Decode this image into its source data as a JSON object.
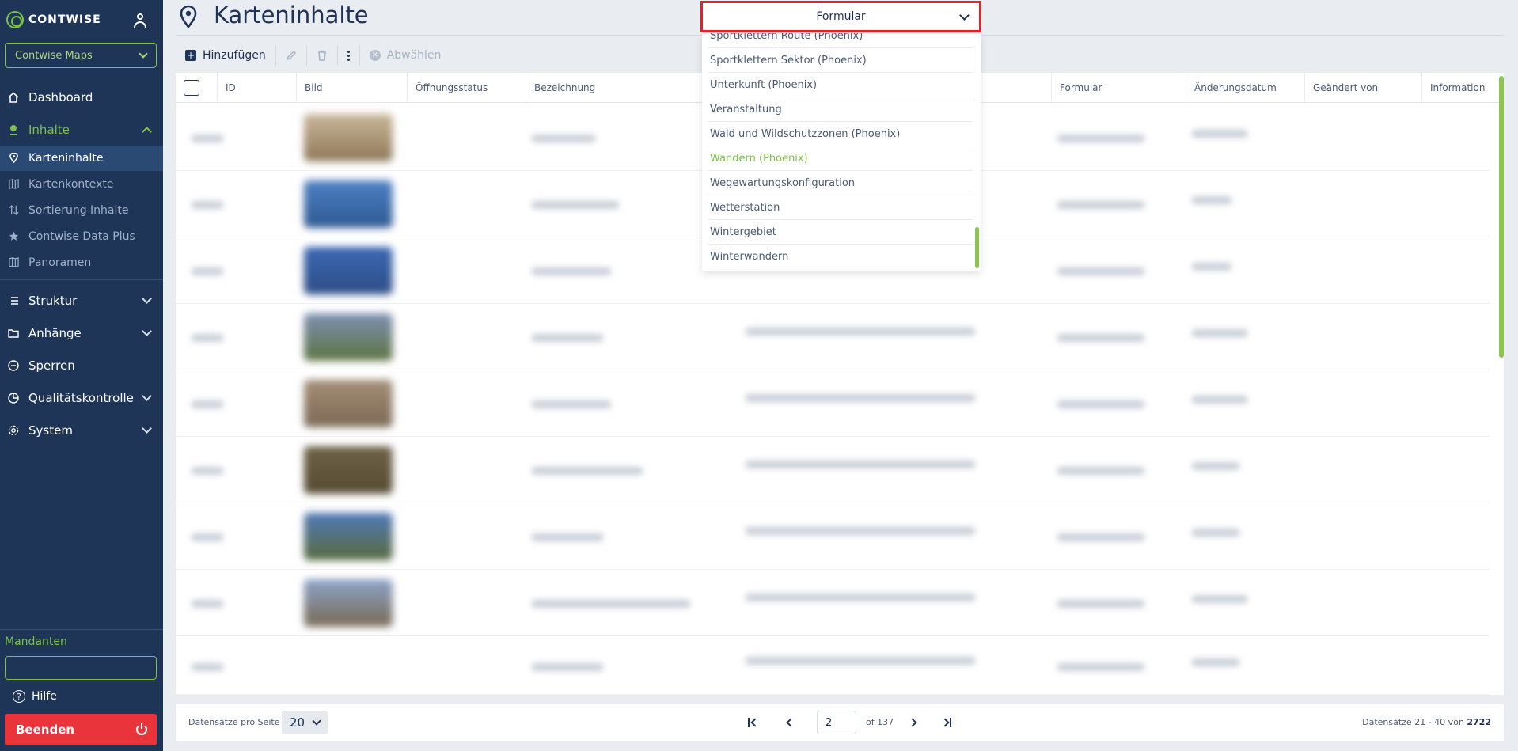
{
  "app": {
    "brand": "CONTWISE",
    "tenant": "Contwise Maps"
  },
  "sidebar": {
    "items": [
      {
        "label": "Dashboard"
      },
      {
        "label": "Inhalte"
      },
      {
        "label": "Struktur"
      },
      {
        "label": "Anhänge"
      },
      {
        "label": "Sperren"
      },
      {
        "label": "Qualitätskontrolle"
      },
      {
        "label": "System"
      }
    ],
    "subitems": [
      {
        "label": "Karteninhalte"
      },
      {
        "label": "Kartenkontexte"
      },
      {
        "label": "Sortierung Inhalte"
      },
      {
        "label": "Contwise Data Plus"
      },
      {
        "label": "Panoramen"
      }
    ],
    "mandanten_label": "Mandanten",
    "mandanten_value": "",
    "help": "Hilfe",
    "logout": "Beenden"
  },
  "header": {
    "title": "Karteninhalte"
  },
  "toolbar": {
    "add": "Hinzufügen",
    "deselect": "Abwählen"
  },
  "filter": {
    "selected": "Formular",
    "options": [
      "Sportklettern Route (Phoenix)",
      "Sportklettern Sektor (Phoenix)",
      "Unterkunft (Phoenix)",
      "Veranstaltung",
      "Wald und Wildschutzzonen (Phoenix)",
      "Wandern (Phoenix)",
      "Wegewartungskonfiguration",
      "Wetterstation",
      "Wintergebiet",
      "Winterwandern"
    ],
    "highlighted": "Wandern (Phoenix)"
  },
  "table": {
    "columns": [
      "ID",
      "Bild",
      "Öffnungsstatus",
      "Bezeichnung",
      "Formular",
      "Änderungsdatum",
      "Geändert von",
      "Information"
    ]
  },
  "pager": {
    "per_page_label": "Datensätze pro Seite",
    "per_page": "20",
    "page": "2",
    "of": "of 137",
    "records_label": "Datensätze 21 - 40 von",
    "records_total": "2722"
  }
}
